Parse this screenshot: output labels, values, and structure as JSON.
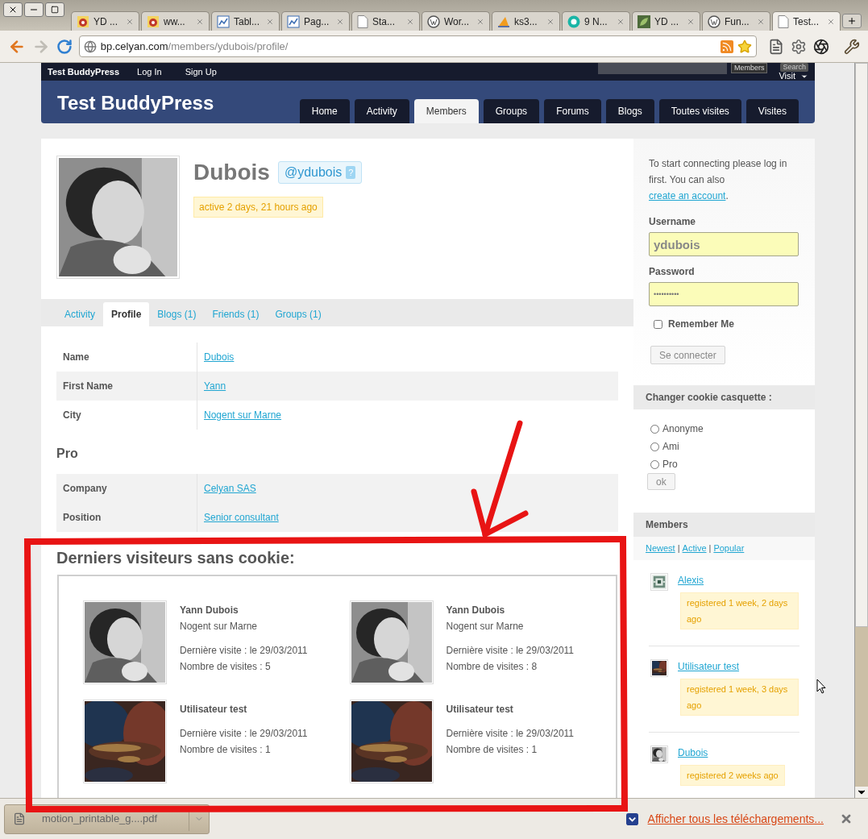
{
  "browser": {
    "tabs": [
      {
        "title": "YD ...",
        "kind": "google",
        "selected": false
      },
      {
        "title": "ww...",
        "kind": "google",
        "selected": false
      },
      {
        "title": "Tabl...",
        "kind": "chart",
        "selected": false
      },
      {
        "title": "Pag...",
        "kind": "chart",
        "selected": false
      },
      {
        "title": "Sta...",
        "kind": "doc",
        "selected": false
      },
      {
        "title": "Wor...",
        "kind": "wordpress",
        "selected": false
      },
      {
        "title": "ks3...",
        "kind": "pma",
        "selected": false
      },
      {
        "title": "9 N...",
        "kind": "nine",
        "selected": false
      },
      {
        "title": "YD ...",
        "kind": "leaf",
        "selected": false
      },
      {
        "title": "Fun...",
        "kind": "wordpress",
        "selected": false
      },
      {
        "title": "Test...",
        "kind": "doc",
        "selected": true
      }
    ],
    "url_host": "bp.celyan.com",
    "url_path": "/members/ydubois/profile/"
  },
  "admin_bar": {
    "site": "Test BuddyPress",
    "links": [
      "Log In",
      "Sign Up"
    ],
    "search_scope": "Members",
    "search_button": "Search",
    "visit": "Visit"
  },
  "header": {
    "title": "Test BuddyPress",
    "nav": [
      {
        "label": "Home",
        "selected": false
      },
      {
        "label": "Activity",
        "selected": false
      },
      {
        "label": "Members",
        "selected": true
      },
      {
        "label": "Groups",
        "selected": false
      },
      {
        "label": "Forums",
        "selected": false
      },
      {
        "label": "Blogs",
        "selected": false
      },
      {
        "label": "Toutes visites",
        "selected": false
      },
      {
        "label": "Visites",
        "selected": false
      }
    ]
  },
  "profile": {
    "name": "Dubois",
    "handle": "@ydubois",
    "handle_help": "?",
    "activity": "active 2 days, 21 hours ago",
    "tabs": [
      {
        "label": "Activity",
        "selected": false
      },
      {
        "label": "Profile",
        "selected": true
      },
      {
        "label": "Blogs (1)",
        "selected": false
      },
      {
        "label": "Friends (1)",
        "selected": false
      },
      {
        "label": "Groups (1)",
        "selected": false
      }
    ],
    "groups": [
      {
        "fields": [
          {
            "label": "Name",
            "value": "Dubois",
            "shaded": false
          },
          {
            "label": "First Name",
            "value": "Yann",
            "shaded": true
          },
          {
            "label": "City",
            "value": "Nogent sur Marne",
            "shaded": false
          }
        ]
      },
      {
        "title": "Pro",
        "fields": [
          {
            "label": "Company",
            "value": "Celyan SAS",
            "shaded": true
          },
          {
            "label": "Position",
            "value": "Senior consultant",
            "shaded": true
          }
        ]
      }
    ]
  },
  "visitors": {
    "title": "Derniers visiteurs sans cookie:",
    "entries": [
      {
        "name": "Yann Dubois",
        "city": "Nogent sur Marne",
        "last_visit": "Dernière visite : le 29/03/2011",
        "visits": "Nombre de visites : 5",
        "kind": "portrait"
      },
      {
        "name": "Yann Dubois",
        "city": "Nogent sur Marne",
        "last_visit": "Dernière visite : le 29/03/2011",
        "visits": "Nombre de visites : 8",
        "kind": "portrait"
      },
      {
        "name": "Utilisateur test",
        "last_visit": "Dernière visite : le 29/03/2011",
        "visits": "Nombre de visites : 1",
        "kind": "poster"
      },
      {
        "name": "Utilisateur test",
        "last_visit": "Dernière visite : le 29/03/2011",
        "visits": "Nombre de visites : 1",
        "kind": "poster"
      }
    ]
  },
  "sidebar": {
    "login": {
      "intro": "To start connecting please log in first. You can also",
      "link": "create an account",
      "after": ".",
      "username_label": "Username",
      "username": "ydubois",
      "password_label": "Password",
      "password": "••••••••••",
      "remember": {
        "label": "Remember Me",
        "checked": false
      },
      "submit": "Se connecter"
    },
    "cookie": {
      "title": "Changer cookie casquette :",
      "options": [
        {
          "label": "Anonyme",
          "selected": false
        },
        {
          "label": "Ami",
          "selected": false
        },
        {
          "label": "Pro",
          "selected": false
        }
      ],
      "submit": "ok"
    },
    "members": {
      "title": "Members",
      "separator": "|",
      "filters": [
        "Newest",
        "Active",
        "Popular"
      ],
      "list": [
        {
          "name": "Alexis",
          "registered": "registered 1 week, 2 days ago",
          "kind": "pattern"
        },
        {
          "name": "Utilisateur test",
          "registered": "registered 1 week, 3 days ago",
          "kind": "poster"
        },
        {
          "name": "Dubois",
          "registered": "registered 2 weeks ago",
          "kind": "portrait"
        }
      ]
    }
  },
  "downloads": {
    "file": "motion_printable_g....pdf",
    "show_all": "Afficher tous les téléchargements..."
  }
}
